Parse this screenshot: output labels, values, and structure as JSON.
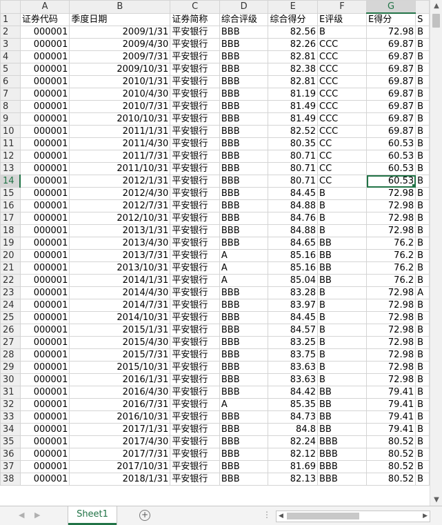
{
  "columns": [
    "A",
    "B",
    "C",
    "D",
    "E",
    "F",
    "G"
  ],
  "header_row": [
    "证券代码",
    "季度日期",
    "证券简称",
    "综合评级",
    "综合得分",
    "E评级",
    "E得分",
    "S"
  ],
  "rows": [
    [
      "2",
      "000001",
      "2009/1/31",
      "平安银行",
      "BBB",
      "82.56",
      "B",
      "72.98",
      "B"
    ],
    [
      "3",
      "000001",
      "2009/4/30",
      "平安银行",
      "BBB",
      "82.26",
      "CCC",
      "69.87",
      "B"
    ],
    [
      "4",
      "000001",
      "2009/7/31",
      "平安银行",
      "BBB",
      "82.81",
      "CCC",
      "69.87",
      "B"
    ],
    [
      "5",
      "000001",
      "2009/10/31",
      "平安银行",
      "BBB",
      "82.38",
      "CCC",
      "69.87",
      "B"
    ],
    [
      "6",
      "000001",
      "2010/1/31",
      "平安银行",
      "BBB",
      "82.81",
      "CCC",
      "69.87",
      "B"
    ],
    [
      "7",
      "000001",
      "2010/4/30",
      "平安银行",
      "BBB",
      "81.19",
      "CCC",
      "69.87",
      "B"
    ],
    [
      "8",
      "000001",
      "2010/7/31",
      "平安银行",
      "BBB",
      "81.49",
      "CCC",
      "69.87",
      "B"
    ],
    [
      "9",
      "000001",
      "2010/10/31",
      "平安银行",
      "BBB",
      "81.49",
      "CCC",
      "69.87",
      "B"
    ],
    [
      "10",
      "000001",
      "2011/1/31",
      "平安银行",
      "BBB",
      "82.52",
      "CCC",
      "69.87",
      "B"
    ],
    [
      "11",
      "000001",
      "2011/4/30",
      "平安银行",
      "BBB",
      "80.35",
      "CC",
      "60.53",
      "B"
    ],
    [
      "12",
      "000001",
      "2011/7/31",
      "平安银行",
      "BBB",
      "80.71",
      "CC",
      "60.53",
      "B"
    ],
    [
      "13",
      "000001",
      "2011/10/31",
      "平安银行",
      "BBB",
      "80.71",
      "CC",
      "60.53",
      "B"
    ],
    [
      "14",
      "000001",
      "2012/1/31",
      "平安银行",
      "BBB",
      "80.71",
      "CC",
      "60.53",
      "B"
    ],
    [
      "15",
      "000001",
      "2012/4/30",
      "平安银行",
      "BBB",
      "84.45",
      "B",
      "72.98",
      "B"
    ],
    [
      "16",
      "000001",
      "2012/7/31",
      "平安银行",
      "BBB",
      "84.88",
      "B",
      "72.98",
      "B"
    ],
    [
      "17",
      "000001",
      "2012/10/31",
      "平安银行",
      "BBB",
      "84.76",
      "B",
      "72.98",
      "B"
    ],
    [
      "18",
      "000001",
      "2013/1/31",
      "平安银行",
      "BBB",
      "84.88",
      "B",
      "72.98",
      "B"
    ],
    [
      "19",
      "000001",
      "2013/4/30",
      "平安银行",
      "BBB",
      "84.65",
      "BB",
      "76.2",
      "B"
    ],
    [
      "20",
      "000001",
      "2013/7/31",
      "平安银行",
      "A",
      "85.16",
      "BB",
      "76.2",
      "B"
    ],
    [
      "21",
      "000001",
      "2013/10/31",
      "平安银行",
      "A",
      "85.16",
      "BB",
      "76.2",
      "B"
    ],
    [
      "22",
      "000001",
      "2014/1/31",
      "平安银行",
      "A",
      "85.04",
      "BB",
      "76.2",
      "B"
    ],
    [
      "23",
      "000001",
      "2014/4/30",
      "平安银行",
      "BBB",
      "83.28",
      "B",
      "72.98",
      "A"
    ],
    [
      "24",
      "000001",
      "2014/7/31",
      "平安银行",
      "BBB",
      "83.97",
      "B",
      "72.98",
      "B"
    ],
    [
      "25",
      "000001",
      "2014/10/31",
      "平安银行",
      "BBB",
      "84.45",
      "B",
      "72.98",
      "B"
    ],
    [
      "26",
      "000001",
      "2015/1/31",
      "平安银行",
      "BBB",
      "84.57",
      "B",
      "72.98",
      "B"
    ],
    [
      "27",
      "000001",
      "2015/4/30",
      "平安银行",
      "BBB",
      "83.25",
      "B",
      "72.98",
      "B"
    ],
    [
      "28",
      "000001",
      "2015/7/31",
      "平安银行",
      "BBB",
      "83.75",
      "B",
      "72.98",
      "B"
    ],
    [
      "29",
      "000001",
      "2015/10/31",
      "平安银行",
      "BBB",
      "83.63",
      "B",
      "72.98",
      "B"
    ],
    [
      "30",
      "000001",
      "2016/1/31",
      "平安银行",
      "BBB",
      "83.63",
      "B",
      "72.98",
      "B"
    ],
    [
      "31",
      "000001",
      "2016/4/30",
      "平安银行",
      "BBB",
      "84.42",
      "BB",
      "79.41",
      "B"
    ],
    [
      "32",
      "000001",
      "2016/7/31",
      "平安银行",
      "A",
      "85.35",
      "BB",
      "79.41",
      "B"
    ],
    [
      "33",
      "000001",
      "2016/10/31",
      "平安银行",
      "BBB",
      "84.73",
      "BB",
      "79.41",
      "B"
    ],
    [
      "34",
      "000001",
      "2017/1/31",
      "平安银行",
      "BBB",
      "84.8",
      "BB",
      "79.41",
      "B"
    ],
    [
      "35",
      "000001",
      "2017/4/30",
      "平安银行",
      "BBB",
      "82.24",
      "BBB",
      "80.52",
      "B"
    ],
    [
      "36",
      "000001",
      "2017/7/31",
      "平安银行",
      "BBB",
      "82.12",
      "BBB",
      "80.52",
      "B"
    ],
    [
      "37",
      "000001",
      "2017/10/31",
      "平安银行",
      "BBB",
      "81.69",
      "BBB",
      "80.52",
      "B"
    ],
    [
      "38",
      "000001",
      "2018/1/31",
      "平安银行",
      "BBB",
      "82.13",
      "BBB",
      "80.52",
      "B"
    ]
  ],
  "selected": {
    "row": "14",
    "column": "G"
  },
  "sheet_tab": "Sheet1",
  "add_sheet_symbol": "+",
  "accent_color": "#217346"
}
